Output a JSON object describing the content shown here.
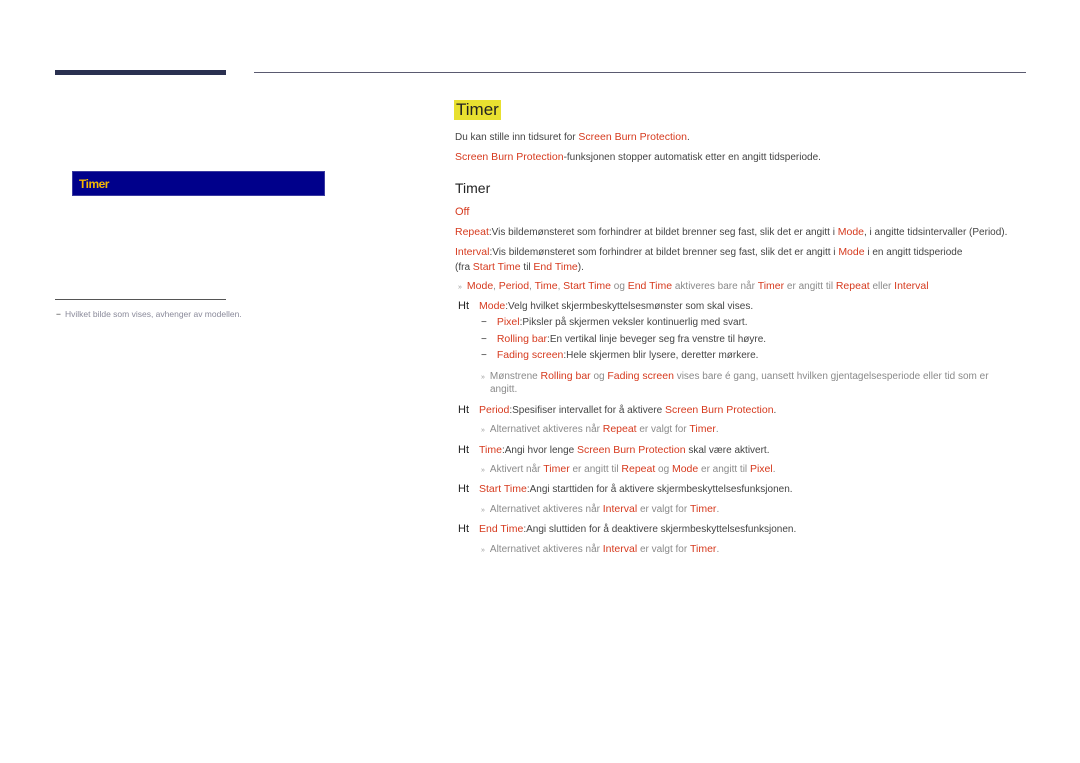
{
  "sidebar": {
    "selected_item": "Timer",
    "footnote": "Hvilket bilde som vises, avhenger av modellen."
  },
  "main": {
    "title": "Timer",
    "intro1": {
      "text": "Du kan stille inn tidsuret for ",
      "link": "Screen Burn Protection",
      "end": "."
    },
    "intro2": {
      "link": "Screen Burn Protection",
      "text": "-funksjonen stopper automatisk etter en angitt tidsperiode."
    },
    "subheading": "Timer",
    "off": "Off",
    "repeat": {
      "label": "Repeat",
      "text1": ":Vis bildemønsteret som forhindrer at bildet brenner seg fast, slik det er angitt i ",
      "mode": "Mode",
      "text2": ", i angitte tidsintervaller (Period)."
    },
    "interval": {
      "label": "Interval",
      "text1": ":Vis bildemønsteret som forhindrer at bildet brenner seg fast, slik det er angitt i ",
      "mode": "Mode",
      "text2": " i en angitt tidsperiode",
      "line2a": "(fra ",
      "start": "Start Time",
      "line2b": " til ",
      "end": "End Time",
      "line2c": ")."
    },
    "note1": {
      "mode": "Mode",
      "period": "Period",
      "time": "Time",
      "start": "Start Time",
      "og": " og ",
      "end": "End Time",
      "text": " aktiveres bare når ",
      "timer": "Timer",
      "text2": " er angitt til ",
      "repeat": "Repeat",
      "eller": " eller ",
      "interval": "Interval"
    },
    "ht_marker": "Ht",
    "mode": {
      "label": "Mode",
      "text": ":Velg hvilket skjermbeskyttelsesmønster som skal vises."
    },
    "pixel": {
      "label": "Pixel",
      "text": ":Piksler på skjermen veksler kontinuerlig med svart."
    },
    "rolling": {
      "label": "Rolling bar",
      "text": ":En vertikal linje beveger seg fra venstre til høyre."
    },
    "fading": {
      "label": "Fading screen",
      "text": ":Hele skjermen blir lysere, deretter mørkere."
    },
    "note2": {
      "a": "Mønstrene ",
      "rolling": "Rolling bar",
      "og": " og ",
      "fading": "Fading screen",
      "b": " vises bare é gang, uansett hvilken gjentagelsesperiode eller tid som er",
      "c": "angitt."
    },
    "period": {
      "label": "Period",
      "text": ":Spesifiser intervallet for å aktivere ",
      "link": "Screen Burn Protection",
      "end": "."
    },
    "note3": {
      "a": "Alternativet aktiveres når ",
      "repeat": "Repeat",
      "b": " er valgt for ",
      "timer": "Timer",
      "end": "."
    },
    "time": {
      "label": "Time",
      "text": ":Angi hvor lenge ",
      "link": "Screen Burn Protection",
      "end": " skal være aktivert."
    },
    "note4": {
      "a": "Aktivert når ",
      "timer": "Timer",
      "b": " er angitt til ",
      "repeat": "Repeat",
      "og": " og ",
      "mode": "Mode",
      "c": " er angitt til ",
      "pixel": "Pixel",
      "end": "."
    },
    "start_time": {
      "label": "Start Time",
      "text": ":Angi starttiden for å aktivere skjermbeskyttelsesfunksjonen."
    },
    "note5": {
      "a": "Alternativet aktiveres når ",
      "interval": "Interval",
      "b": " er valgt for ",
      "timer": "Timer",
      "end": "."
    },
    "end_time": {
      "label": "End Time",
      "text": ":Angi sluttiden for å deaktivere skjermbeskyttelsesfunksjonen."
    },
    "note6": {
      "a": "Alternativet aktiveres når ",
      "interval": "Interval",
      "b": " er valgt for ",
      "timer": "Timer",
      "end": "."
    }
  }
}
